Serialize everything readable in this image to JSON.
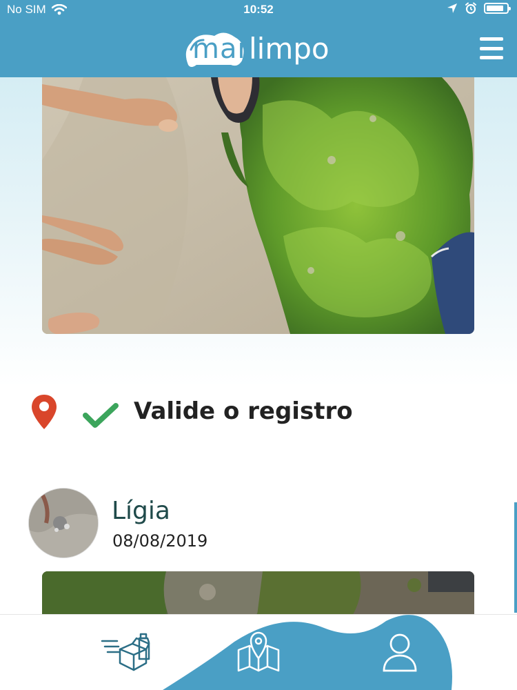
{
  "status_bar": {
    "carrier": "No SIM",
    "time": "10:52",
    "icons": [
      "wifi-icon",
      "location-arrow-icon",
      "alarm-icon",
      "battery-icon"
    ]
  },
  "header": {
    "logo_part1": "mar",
    "logo_part2": "limpo",
    "menu_icon": "hamburger-menu-icon"
  },
  "main_photo": {
    "content": "beach-sand-with-green-algae-and-feet"
  },
  "validation": {
    "location_icon": "location-pin-icon",
    "check_icon": "checkmark-icon",
    "label": "Valide o registro"
  },
  "post": {
    "user_name": "Lígia",
    "date": "08/08/2019"
  },
  "bottom_nav": {
    "items": [
      {
        "icon": "recycling-box-icon"
      },
      {
        "icon": "map-pin-icon"
      },
      {
        "icon": "user-profile-icon"
      }
    ]
  },
  "colors": {
    "brand_blue": "#4a9fc5",
    "pin_red": "#d9462b",
    "check_green": "#3ca55c",
    "name_teal": "#1f4a4a"
  }
}
